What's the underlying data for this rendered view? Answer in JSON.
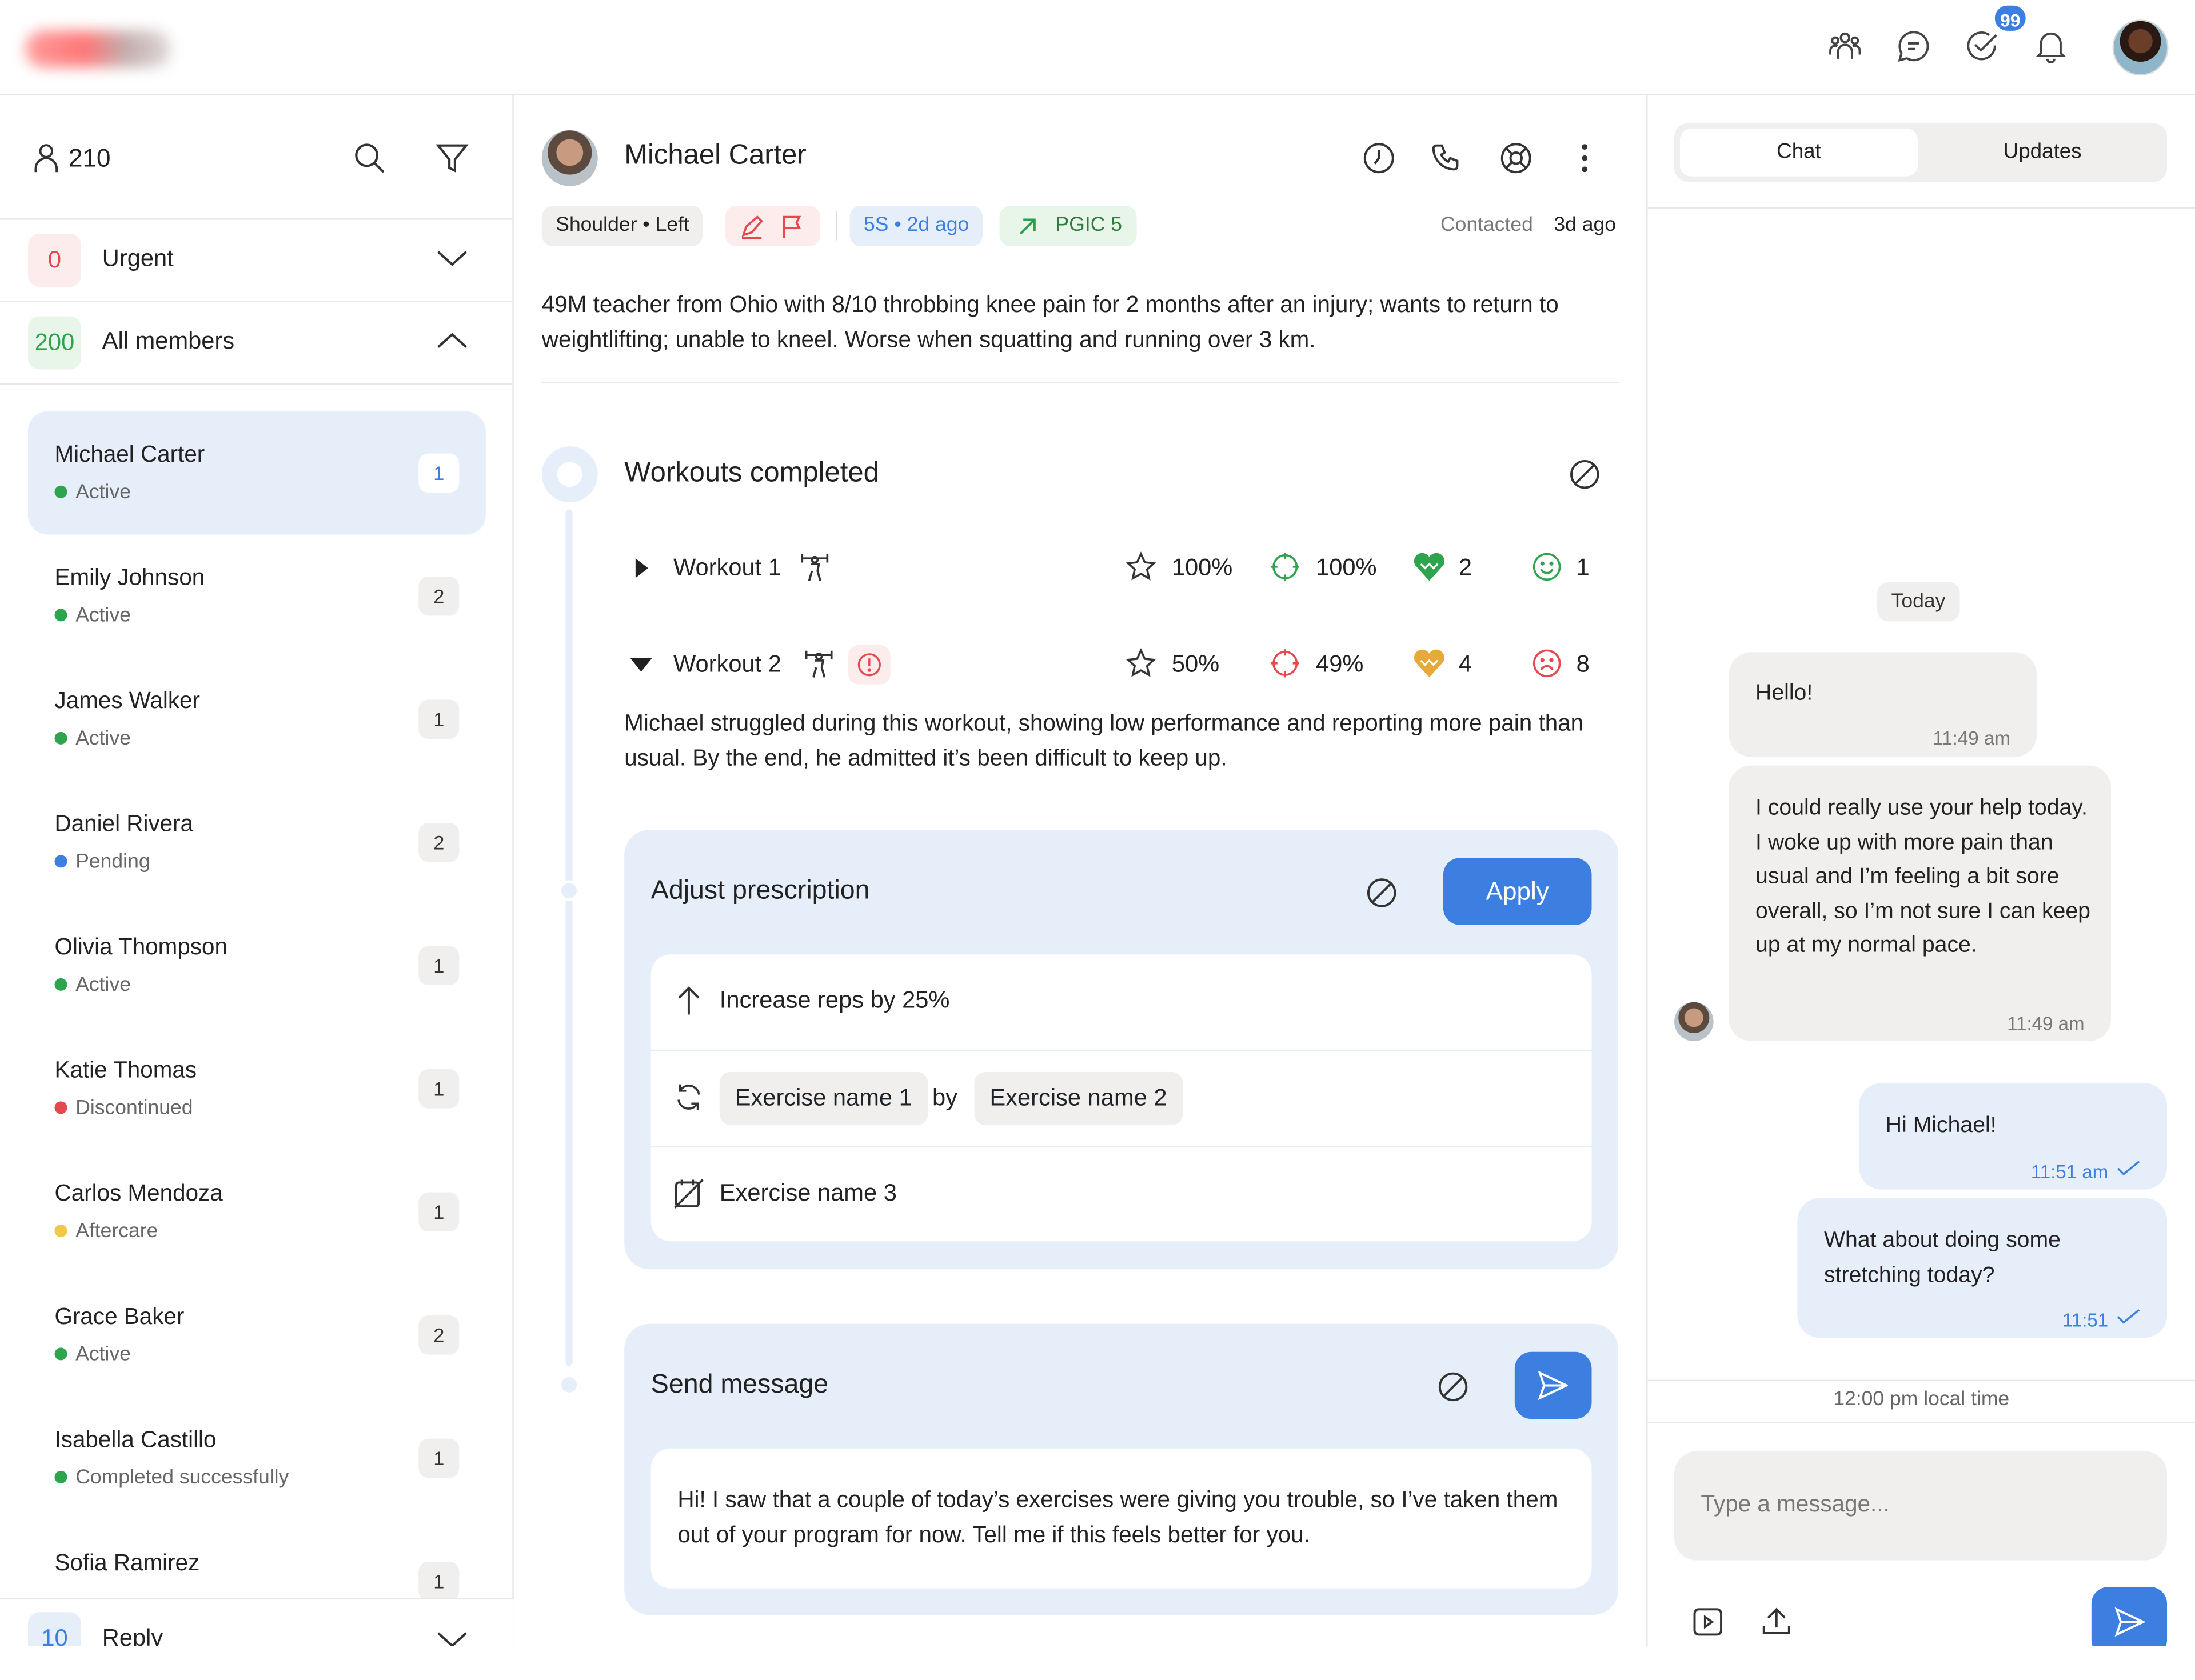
{
  "topbar": {
    "tasks_badge": "99"
  },
  "left": {
    "member_count": "210",
    "urgent": {
      "count": "0",
      "label": "Urgent"
    },
    "all_members": {
      "count": "200",
      "label": "All members"
    },
    "members": [
      {
        "name": "Michael Carter",
        "status": "Active",
        "status_color": "#2ea44f",
        "count": "1"
      },
      {
        "name": "Emily Johnson",
        "status": "Active",
        "status_color": "#2ea44f",
        "count": "2"
      },
      {
        "name": "James Walker",
        "status": "Active",
        "status_color": "#2ea44f",
        "count": "1"
      },
      {
        "name": "Daniel Rivera",
        "status": "Pending",
        "status_color": "#3d7fe0",
        "count": "2"
      },
      {
        "name": "Olivia Thompson",
        "status": "Active",
        "status_color": "#2ea44f",
        "count": "1"
      },
      {
        "name": "Katie Thomas",
        "status": "Discontinued",
        "status_color": "#e5484d",
        "count": "1"
      },
      {
        "name": "Carlos Mendoza",
        "status": "Aftercare",
        "status_color": "#f2c84b",
        "count": "1"
      },
      {
        "name": "Grace Baker",
        "status": "Active",
        "status_color": "#2ea44f",
        "count": "2"
      },
      {
        "name": "Isabella Castillo",
        "status": "Completed successfully",
        "status_color": "#2ea44f",
        "count": "1"
      },
      {
        "name": "Sofia Ramirez",
        "status": "",
        "status_color": "#2ea44f",
        "count": "1"
      }
    ],
    "reply": {
      "count": "10",
      "label": "Reply"
    }
  },
  "patient": {
    "name": "Michael Carter",
    "chip_body": "Shoulder • Left",
    "chip_score": "5S • 2d ago",
    "chip_pgic": "PGIC 5",
    "contacted_label": "Contacted",
    "contacted_value": "3d ago",
    "summary": "49M teacher from Ohio with 8/10 throbbing knee pain for 2 months after an injury; wants to return to weightlifting; unable to kneel. Worse when squatting and running over 3 km."
  },
  "workouts": {
    "title": "Workouts completed",
    "items": [
      {
        "name": "Workout 1",
        "rating": "100%",
        "accuracy": "100%",
        "hearts": "2",
        "mood": "1"
      },
      {
        "name": "Workout 2",
        "rating": "50%",
        "accuracy": "49%",
        "hearts": "4",
        "mood": "8"
      }
    ],
    "note": "Michael struggled during this workout, showing low performance and reporting more pain than usual. By the end, he admitted it’s been difficult to keep up."
  },
  "prescription": {
    "title": "Adjust prescription",
    "apply_label": "Apply",
    "increase": "Increase reps by 25%",
    "swap_from": "Exercise name 1",
    "swap_by": "by",
    "swap_to": "Exercise name 2",
    "remove": "Exercise name 3"
  },
  "send": {
    "title": "Send message",
    "text": "Hi! I saw that a couple of today’s exercises were giving you trouble, so I’ve taken them out of your program for now. Tell me if this feels better for you."
  },
  "chat": {
    "tabs": [
      "Chat",
      "Updates"
    ],
    "day": "Today",
    "messages": [
      {
        "text": "Hello!",
        "time": "11:49 am"
      },
      {
        "text": "I could really use your help today. I woke up with more pain than usual and I’m feeling a bit sore overall, so I’m not sure I can keep up at my normal pace.",
        "time": "11:49 am"
      },
      {
        "text": "Hi Michael!",
        "time": "11:51 am"
      },
      {
        "text": "What about doing some stretching today?",
        "time": "11:51"
      }
    ],
    "local_time": "12:00 pm local time",
    "placeholder": "Type a message..."
  },
  "colors": {
    "accent": "#3d7fe0",
    "card_bg": "#e6eefa",
    "neutral_bg": "#f1efed"
  }
}
